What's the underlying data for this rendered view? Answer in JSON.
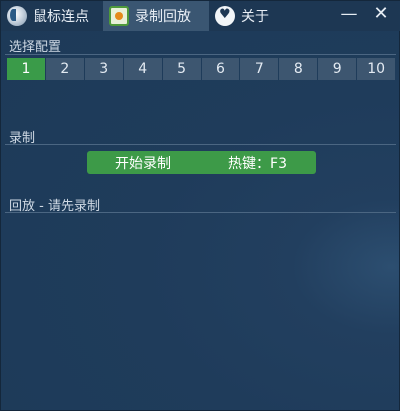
{
  "tabs": [
    {
      "label": "鼠标连点",
      "icon": "mouse-icon"
    },
    {
      "label": "录制回放",
      "icon": "record-icon"
    },
    {
      "label": "关于",
      "icon": "chat-heart-icon"
    }
  ],
  "window_buttons": {
    "minimize": "—",
    "close": "✕"
  },
  "config": {
    "title": "选择配置",
    "options": [
      "1",
      "2",
      "3",
      "4",
      "5",
      "6",
      "7",
      "8",
      "9",
      "10"
    ],
    "selected": "1"
  },
  "record": {
    "title": "录制",
    "button_label": "开始录制",
    "hotkey": "热键：F3"
  },
  "playback": {
    "title": "回放 - 请先录制"
  },
  "colors": {
    "background": "#1e3b5a",
    "titlebar": "#1d3753",
    "active_tab": "#3a5672",
    "accent_green": "#3d9a48",
    "option_bg": "#3d5670"
  }
}
